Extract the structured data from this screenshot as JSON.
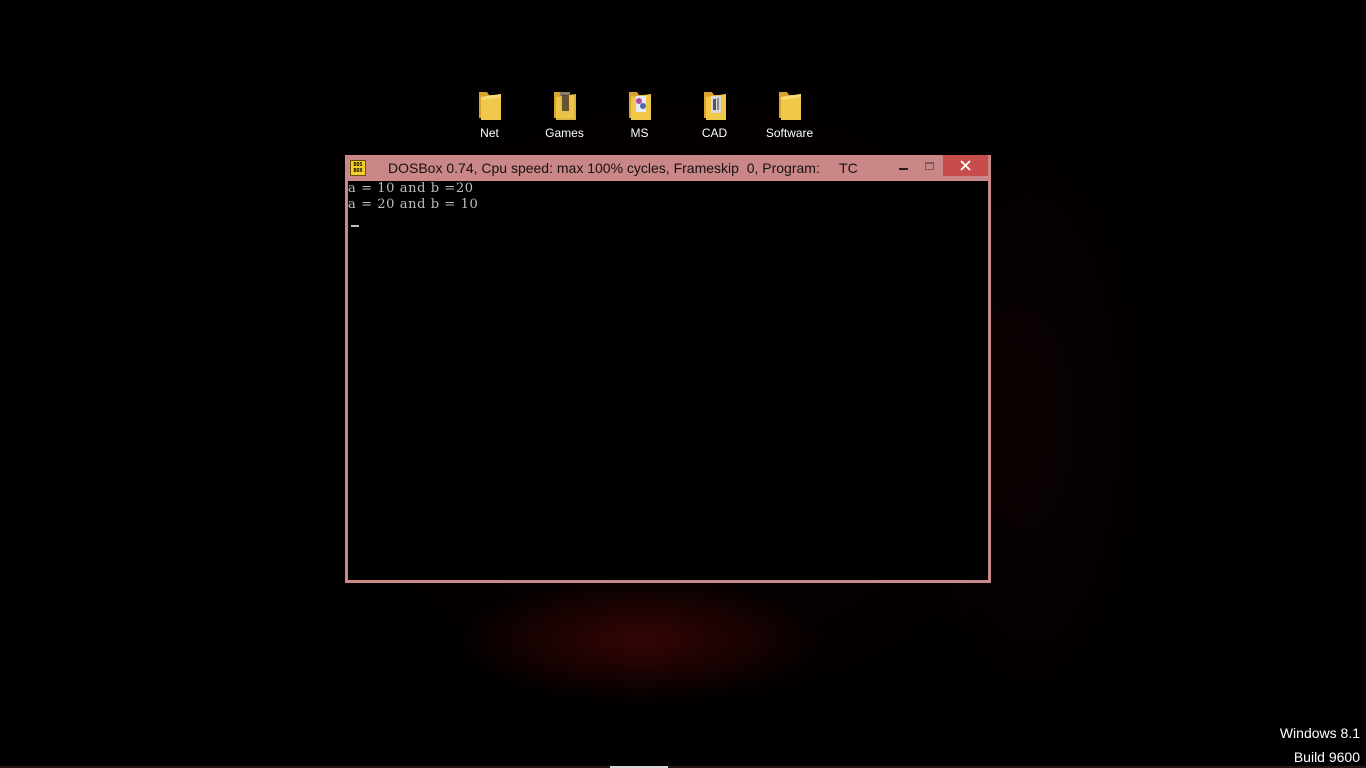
{
  "desktop": {
    "icons": [
      {
        "label": "Net",
        "icon": "folder-icon"
      },
      {
        "label": "Games",
        "icon": "folder-games-icon"
      },
      {
        "label": "MS",
        "icon": "folder-ms-icon"
      },
      {
        "label": "CAD",
        "icon": "folder-cad-icon"
      },
      {
        "label": "Software",
        "icon": "folder-icon"
      }
    ],
    "watermark": {
      "line1": "Windows 8.1",
      "line2": "Build 9600"
    }
  },
  "window": {
    "title": "DOSBox 0.74, Cpu speed: max 100% cycles, Frameskip  0, Program:     TC",
    "app_icon_text": "DOS BOX",
    "controls": {
      "minimize": "–",
      "maximize": "□",
      "close": "✕"
    },
    "console": {
      "lines": [
        "a = 10 and b =20",
        "a = 20 and b = 10"
      ]
    }
  },
  "colors": {
    "frame": "#c98788",
    "close_button": "#c74d4d",
    "folder": "#f0c94a",
    "console_text": "#bdbdbd"
  }
}
